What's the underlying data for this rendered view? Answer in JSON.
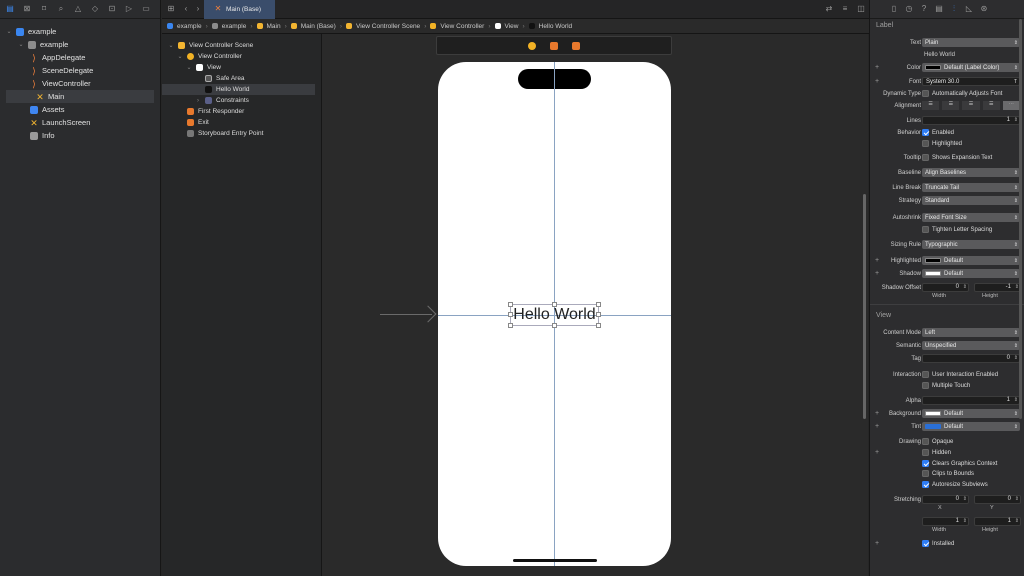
{
  "navigator": {
    "items": [
      {
        "label": "example",
        "level": 0,
        "kind": "project"
      },
      {
        "label": "example",
        "level": 1,
        "kind": "folder"
      },
      {
        "label": "AppDelegate",
        "level": 2,
        "kind": "swift"
      },
      {
        "label": "SceneDelegate",
        "level": 2,
        "kind": "swift"
      },
      {
        "label": "ViewController",
        "level": 2,
        "kind": "swift"
      },
      {
        "label": "Main",
        "level": 2,
        "kind": "storyboard",
        "selected": true
      },
      {
        "label": "Assets",
        "level": 2,
        "kind": "assets"
      },
      {
        "label": "LaunchScreen",
        "level": 2,
        "kind": "storyboard"
      },
      {
        "label": "Info",
        "level": 2,
        "kind": "plist"
      }
    ]
  },
  "editor": {
    "tab_label": "Main (Base)",
    "jumpbar": [
      "example",
      "example",
      "Main",
      "Main (Base)",
      "View Controller Scene",
      "View Controller",
      "View",
      "Hello World"
    ]
  },
  "outline": {
    "items": [
      {
        "label": "View Controller Scene",
        "level": 0,
        "kind": "scene"
      },
      {
        "label": "View Controller",
        "level": 1,
        "kind": "vc"
      },
      {
        "label": "View",
        "level": 2,
        "kind": "view"
      },
      {
        "label": "Safe Area",
        "level": 3,
        "kind": "safearea"
      },
      {
        "label": "Hello World",
        "level": 3,
        "kind": "label",
        "selected": true
      },
      {
        "label": "Constraints",
        "level": 3,
        "kind": "constraints"
      },
      {
        "label": "First Responder",
        "level": 1,
        "kind": "responder"
      },
      {
        "label": "Exit",
        "level": 1,
        "kind": "exit"
      },
      {
        "label": "Storyboard Entry Point",
        "level": 1,
        "kind": "entry"
      }
    ]
  },
  "canvas": {
    "label_text": "Hello World"
  },
  "inspector": {
    "label_section": "Label",
    "view_section": "View",
    "text_label": "Text",
    "text_type": "Plain",
    "text_value": "Hello World",
    "color_label": "Color",
    "color_value": "Default (Label Color)",
    "font_label": "Font",
    "font_value": "System 30.0",
    "dynamic_type_label": "Dynamic Type",
    "dynamic_type_value": "Automatically Adjusts Font",
    "alignment_label": "Alignment",
    "lines_label": "Lines",
    "lines_value": "1",
    "behavior_label": "Behavior",
    "behavior_enabled": "Enabled",
    "behavior_highlighted": "Highlighted",
    "tooltip_label": "Tooltip",
    "tooltip_value": "Shows Expansion Text",
    "baseline_label": "Baseline",
    "baseline_value": "Align Baselines",
    "linebreak_label": "Line Break",
    "linebreak_value": "Truncate Tail",
    "strategy_label": "Strategy",
    "strategy_value": "Standard",
    "autoshrink_label": "Autoshrink",
    "autoshrink_value": "Fixed Font Size",
    "tighten_value": "Tighten Letter Spacing",
    "sizing_label": "Sizing Rule",
    "sizing_value": "Typographic",
    "highlighted_label": "Highlighted",
    "highlighted_value": "Default",
    "shadow_label": "Shadow",
    "shadow_value": "Default",
    "shadow_offset_label": "Shadow Offset",
    "shadow_w": "0",
    "shadow_h": "-1",
    "width_label": "Width",
    "height_label": "Height",
    "content_mode_label": "Content Mode",
    "content_mode_value": "Left",
    "semantic_label": "Semantic",
    "semantic_value": "Unspecified",
    "tag_label": "Tag",
    "tag_value": "0",
    "interaction_label": "Interaction",
    "user_interaction": "User Interaction Enabled",
    "multiple_touch": "Multiple Touch",
    "alpha_label": "Alpha",
    "alpha_value": "1",
    "background_label": "Background",
    "background_value": "Default",
    "tint_label": "Tint",
    "tint_value": "Default",
    "drawing_label": "Drawing",
    "opaque": "Opaque",
    "hidden": "Hidden",
    "clears": "Clears Graphics Context",
    "clips": "Clips to Bounds",
    "autoresize": "Autoresize Subviews",
    "stretching_label": "Stretching",
    "stretch_x": "0",
    "stretch_y": "0",
    "stretch_w": "1",
    "stretch_h": "1",
    "x_label": "X",
    "y_label": "Y",
    "installed": "Installed"
  },
  "colors": {
    "accent": "#2f7df5",
    "tint_swatch": "#2a6fd6",
    "tab_bg": "#3a4d6b"
  }
}
